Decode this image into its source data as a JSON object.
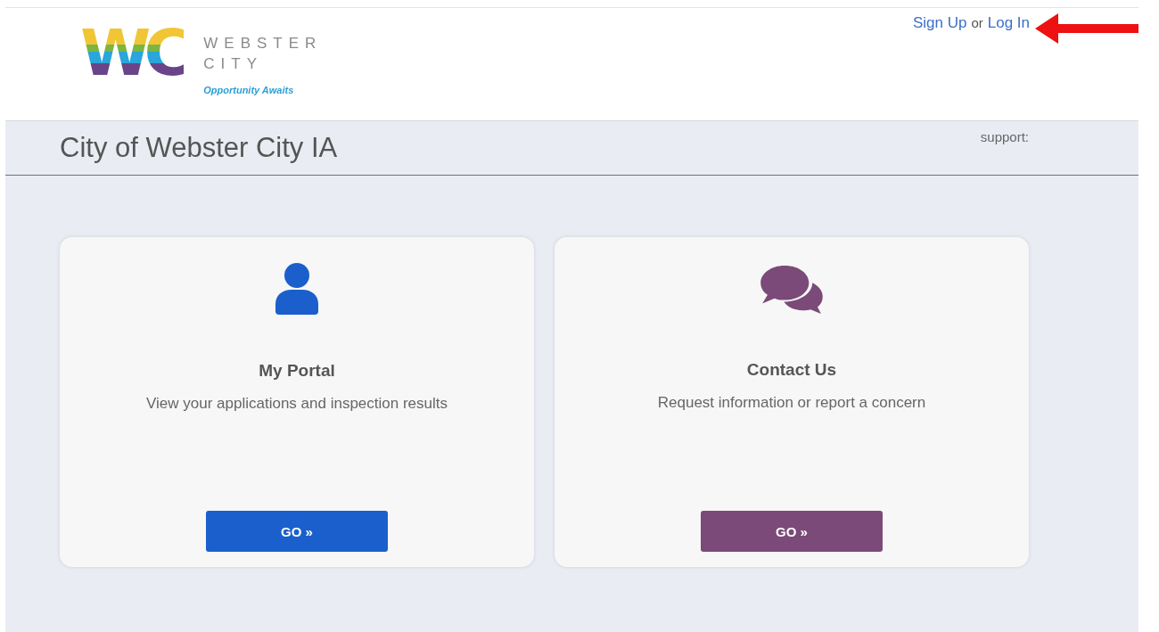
{
  "logo": {
    "mark": "WC",
    "name_lines": [
      "WEBSTER",
      "CITY"
    ],
    "tagline": "Opportunity Awaits"
  },
  "auth": {
    "sign_up": "Sign Up",
    "separator": "or",
    "log_in": "Log In"
  },
  "annotation": {
    "kind": "arrow",
    "color": "#ee1111"
  },
  "header": {
    "title": "City of Webster City IA",
    "support": "support:"
  },
  "cards": [
    {
      "kind": "person",
      "title": "My Portal",
      "description": "View your applications and inspection results",
      "button": "GO »",
      "color": "#1a5fcc"
    },
    {
      "kind": "chat",
      "title": "Contact Us",
      "description": "Request information or report a concern",
      "button": "GO »",
      "color": "#7b4a78"
    }
  ]
}
